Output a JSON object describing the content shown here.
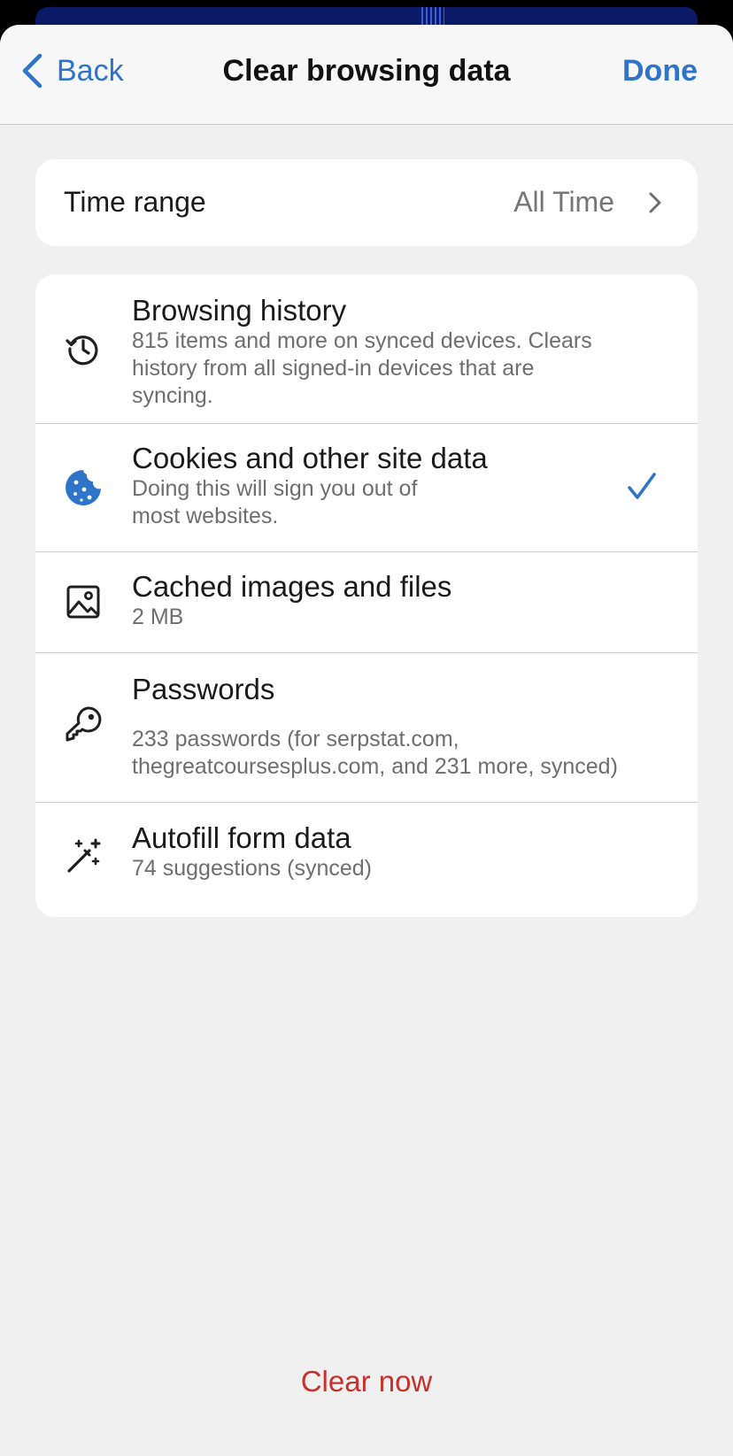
{
  "navbar": {
    "back_label": "Back",
    "title": "Clear browsing data",
    "done_label": "Done"
  },
  "time_range": {
    "label": "Time range",
    "value": "All Time"
  },
  "options": [
    {
      "title": "Browsing history",
      "subtitle_lines": [
        "815 items and more on synced devices. Clears",
        "history from all signed-in devices that are",
        "syncing."
      ],
      "icon": "history-icon",
      "checked": false
    },
    {
      "title": "Cookies and other site data",
      "subtitle_lines": [
        "Doing this will sign you out of",
        "most websites."
      ],
      "icon": "cookie-icon",
      "checked": true
    },
    {
      "title": "Cached images and files",
      "subtitle_lines": [
        "2 MB"
      ],
      "icon": "image-icon",
      "checked": false
    },
    {
      "title": "Passwords",
      "subtitle_lines": [
        "233 passwords (for serpstat.com,",
        "thegreatcoursesplus.com, and 231 more, synced)"
      ],
      "icon": "key-icon",
      "checked": false
    },
    {
      "title": "Autofill form data",
      "subtitle_lines": [
        "74 suggestions (synced)"
      ],
      "icon": "magic-wand-icon",
      "checked": false
    }
  ],
  "clear_label": "Clear now",
  "colors": {
    "accent_blue": "#2e74c8",
    "destructive_red": "#c8312b",
    "sheet_background": "#f0f0f0"
  }
}
